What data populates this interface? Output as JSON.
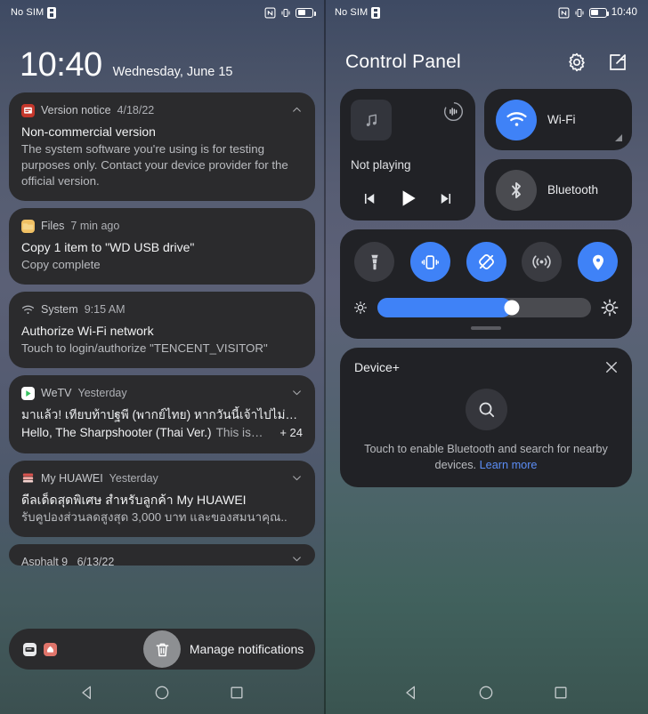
{
  "statusbar": {
    "sim_text": "No SIM",
    "icons": [
      "sim-card-icon",
      "nfc-icon",
      "vibrate-icon",
      "battery-icon"
    ],
    "clock_right": "10:40"
  },
  "lockscreen": {
    "time": "10:40",
    "date": "Wednesday, June 15",
    "notifications": [
      {
        "app": "Version notice",
        "time": "4/18/22",
        "icon": "version-notice-icon",
        "icon_color": "#c5372c",
        "chevron": "chevron-up-icon",
        "title": "Non-commercial version",
        "body": "The system software you're using is for testing purposes only. Contact your device provider for the official version."
      },
      {
        "app": "Files",
        "time": "7 min ago",
        "icon": "files-icon",
        "icon_color": "#f0c064",
        "chevron": null,
        "title": "Copy 1 item to \"WD USB drive\"",
        "body": "Copy complete"
      },
      {
        "app": "System",
        "time": "9:15 AM",
        "icon": "wifi-small-icon",
        "icon_color": "transparent",
        "chevron": null,
        "title": "Authorize Wi-Fi network",
        "body": "Touch to login/authorize \"TENCENT_VISITOR\""
      },
      {
        "app": "WeTV",
        "time": "Yesterday",
        "icon": "wetv-icon",
        "icon_color": "#ffffff",
        "chevron": "chevron-down-icon",
        "line1": "มาแล้ว! เทียบท้าปฐพี (พากย์ไทย) หากวันนี้เจ้าไปไม่…",
        "line2_bold": "Hello, The Sharpshooter (Thai Ver.)",
        "line2_dim": "This is…",
        "count": "+ 24"
      },
      {
        "app": "My HUAWEI",
        "time": "Yesterday",
        "icon": "my-huawei-icon",
        "icon_color": "#e8817f",
        "chevron": "chevron-down-icon",
        "title": "ดีลเด็ดสุดพิเศษ สำหรับลูกค้า My HUAWEI",
        "body": "รับคูปองส่วนลดสูงสุด 3,000 บาท และของสมนาคุณ.."
      }
    ],
    "partial_notification": {
      "app": "Asphalt 9",
      "time": "6/13/22",
      "chevron": "chevron-down-icon"
    },
    "footer": {
      "manage_label": "Manage notifications",
      "trash_icon": "trash-icon",
      "mini_icons": [
        "screenshot-icon",
        "huawei-app-icon"
      ]
    }
  },
  "control_panel": {
    "title": "Control Panel",
    "actions": [
      {
        "name": "settings-gear-icon"
      },
      {
        "name": "edit-icon"
      }
    ],
    "media": {
      "status": "Not playing",
      "album_icon": "music-note-icon",
      "cast_icon": "audio-cast-icon",
      "prev_label": "previous-track",
      "play_label": "play",
      "next_label": "next-track"
    },
    "connectivity": [
      {
        "label": "Wi-Fi",
        "icon": "wifi-icon",
        "state": "on",
        "expandable": true
      },
      {
        "label": "Bluetooth",
        "icon": "bluetooth-icon",
        "state": "off",
        "expandable": false
      }
    ],
    "toggles": [
      {
        "name": "flashlight-icon",
        "state": "off"
      },
      {
        "name": "vibrate-icon",
        "state": "on"
      },
      {
        "name": "rotation-lock-icon",
        "state": "on"
      },
      {
        "name": "hotspot-icon",
        "state": "off"
      },
      {
        "name": "location-icon",
        "state": "on"
      }
    ],
    "brightness": {
      "value_percent": 63,
      "low_icon": "brightness-low-icon",
      "high_icon": "brightness-high-icon"
    },
    "device_plus": {
      "title": "Device+",
      "close_icon": "close-icon",
      "search_icon": "search-icon",
      "description": "Touch to enable Bluetooth and search for nearby devices.",
      "link_text": "Learn more"
    }
  },
  "navbar": {
    "items": [
      {
        "name": "back-button",
        "icon": "triangle-left-icon"
      },
      {
        "name": "home-button",
        "icon": "circle-icon"
      },
      {
        "name": "recents-button",
        "icon": "square-icon"
      }
    ]
  },
  "colors": {
    "accent": "#3f82f7",
    "card_dark": "#2b2b2d",
    "card_cp": "#212226",
    "link": "#5b8df5"
  }
}
